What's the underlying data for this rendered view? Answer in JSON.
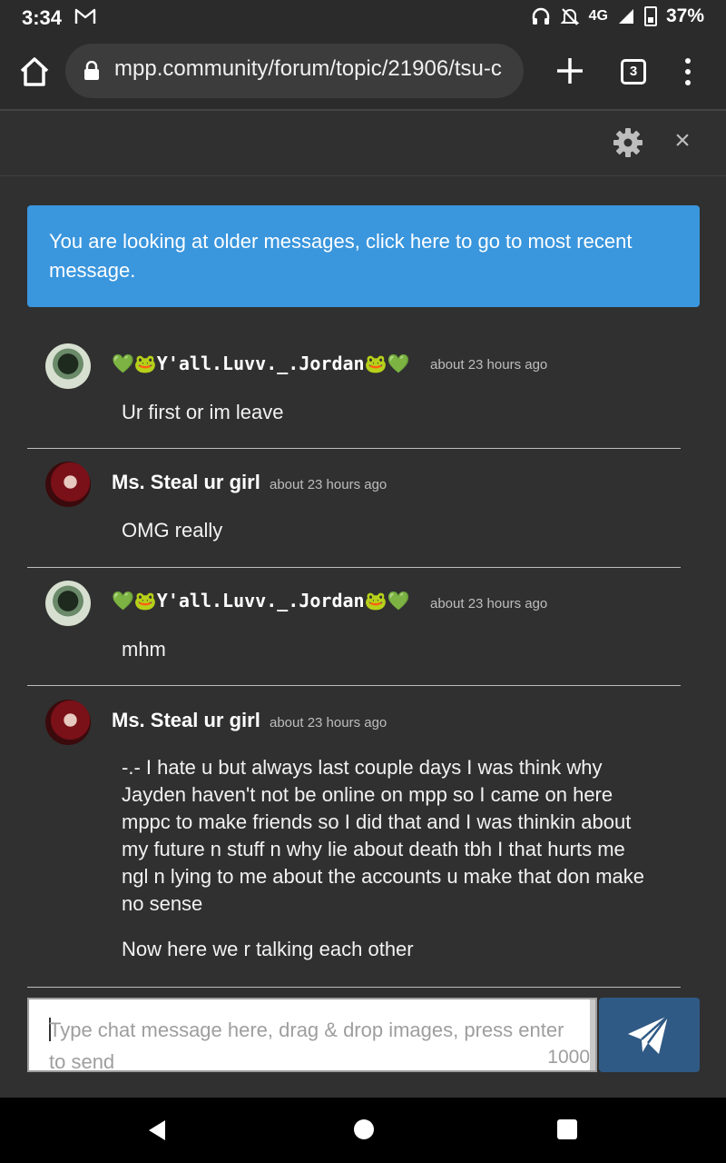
{
  "status_bar": {
    "time": "3:34",
    "network": "4G",
    "battery": "37%",
    "icons": [
      "gmail-icon",
      "headphones-icon",
      "notifications-off-icon",
      "signal-icon",
      "battery-icon"
    ]
  },
  "browser": {
    "url": "mpp.community/forum/topic/21906/tsu-c",
    "tab_count": "3",
    "icons": [
      "home-icon",
      "lock-icon",
      "plus-icon",
      "more-vert-icon"
    ]
  },
  "chat": {
    "header_icons": [
      "gear-icon",
      "close-icon"
    ],
    "close_label": "×",
    "banner": "You are looking at older messages, click here to go to most recent message.",
    "messages": [
      {
        "user": "💚🐸Y'all.Luvv._.Jordan🐸💚",
        "time": "about 23 hours ago",
        "text": "Ur first or im leave"
      },
      {
        "user": "Ms. Steal ur girl",
        "time": "about 23 hours ago",
        "text": "OMG really"
      },
      {
        "user": "💚🐸Y'all.Luvv._.Jordan🐸💚",
        "time": "about 23 hours ago",
        "text": "mhm"
      },
      {
        "user": "Ms. Steal ur girl",
        "time": "about 23 hours ago",
        "text": "-.- I hate u but always last couple days I was think why Jayden haven't not be online on mpp so I came on here mppc to make friends so I did that and I was thinkin about my future n stuff n why lie about death tbh I that hurts me ngl n lying to me about the accounts u make that don make no sense",
        "text2": "Now here we r talking each other"
      }
    ],
    "composer": {
      "placeholder": "Type chat message here, drag & drop images, press enter to send",
      "char_count": "1000"
    },
    "accent_colors": {
      "banner": "#3a96dd",
      "send_button": "#2f5a85"
    }
  },
  "nav_bar": {
    "icons": [
      "back-icon",
      "home-circle-icon",
      "recents-icon"
    ]
  }
}
